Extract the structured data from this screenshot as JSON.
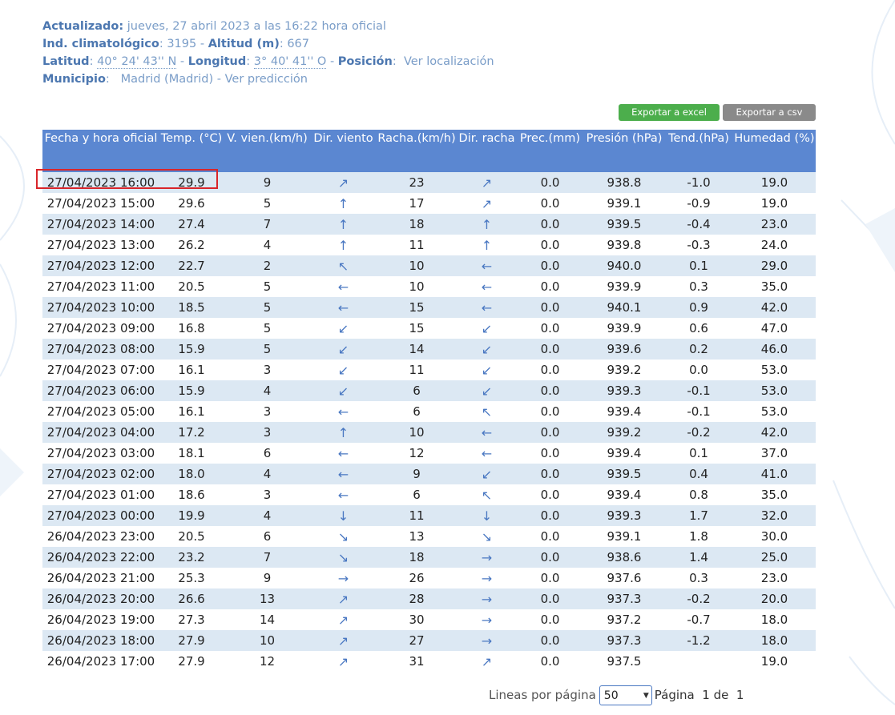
{
  "info": {
    "actualizado_label": "Actualizado:",
    "actualizado_value": "jueves, 27 abril 2023 a las 16:22 hora oficial",
    "ind_label": "Ind. climatológico",
    "ind_value": ": 3195 - ",
    "altitud_label": "Altitud (m)",
    "altitud_value": ": 667",
    "latitud_label": "Latitud",
    "latitud_value": "40° 24' 43'' N",
    "longitud_label": "Longitud",
    "longitud_value": "3° 40' 41'' O",
    "posicion_label": "Posición",
    "posicion_link": "Ver localización",
    "municipio_label": "Municipio",
    "municipio_value": "Madrid (Madrid)",
    "prediccion_link": "Ver predicción"
  },
  "buttons": {
    "excel": "Exportar a excel",
    "csv": "Exportar a csv"
  },
  "table": {
    "headers": [
      "Fecha y hora oficial",
      "Temp. (°C)",
      "V. vien.(km/h)",
      "Dir. viento",
      "Racha.(km/h)",
      "Dir. racha",
      "Prec.(mm)",
      "Presión (hPa)",
      "Tend.(hPa)",
      "Humedad (%)"
    ],
    "rows": [
      [
        "27/04/2023 16:00",
        "29.9",
        "9",
        "ne",
        "23",
        "ne",
        "0.0",
        "938.8",
        "-1.0",
        "19.0"
      ],
      [
        "27/04/2023 15:00",
        "29.6",
        "5",
        "n",
        "17",
        "ne",
        "0.0",
        "939.1",
        "-0.9",
        "19.0"
      ],
      [
        "27/04/2023 14:00",
        "27.4",
        "7",
        "n",
        "18",
        "n",
        "0.0",
        "939.5",
        "-0.4",
        "23.0"
      ],
      [
        "27/04/2023 13:00",
        "26.2",
        "4",
        "n",
        "11",
        "n",
        "0.0",
        "939.8",
        "-0.3",
        "24.0"
      ],
      [
        "27/04/2023 12:00",
        "22.7",
        "2",
        "nw",
        "10",
        "w",
        "0.0",
        "940.0",
        "0.1",
        "29.0"
      ],
      [
        "27/04/2023 11:00",
        "20.5",
        "5",
        "w",
        "10",
        "w",
        "0.0",
        "939.9",
        "0.3",
        "35.0"
      ],
      [
        "27/04/2023 10:00",
        "18.5",
        "5",
        "w",
        "15",
        "w",
        "0.0",
        "940.1",
        "0.9",
        "42.0"
      ],
      [
        "27/04/2023 09:00",
        "16.8",
        "5",
        "sw",
        "15",
        "sw",
        "0.0",
        "939.9",
        "0.6",
        "47.0"
      ],
      [
        "27/04/2023 08:00",
        "15.9",
        "5",
        "sw",
        "14",
        "sw",
        "0.0",
        "939.6",
        "0.2",
        "46.0"
      ],
      [
        "27/04/2023 07:00",
        "16.1",
        "3",
        "sw",
        "11",
        "sw",
        "0.0",
        "939.2",
        "0.0",
        "53.0"
      ],
      [
        "27/04/2023 06:00",
        "15.9",
        "4",
        "sw",
        "6",
        "sw",
        "0.0",
        "939.3",
        "-0.1",
        "53.0"
      ],
      [
        "27/04/2023 05:00",
        "16.1",
        "3",
        "w",
        "6",
        "nw",
        "0.0",
        "939.4",
        "-0.1",
        "53.0"
      ],
      [
        "27/04/2023 04:00",
        "17.2",
        "3",
        "n",
        "10",
        "w",
        "0.0",
        "939.2",
        "-0.2",
        "42.0"
      ],
      [
        "27/04/2023 03:00",
        "18.1",
        "6",
        "w",
        "12",
        "w",
        "0.0",
        "939.4",
        "0.1",
        "37.0"
      ],
      [
        "27/04/2023 02:00",
        "18.0",
        "4",
        "w",
        "9",
        "sw",
        "0.0",
        "939.5",
        "0.4",
        "41.0"
      ],
      [
        "27/04/2023 01:00",
        "18.6",
        "3",
        "w",
        "6",
        "nw",
        "0.0",
        "939.4",
        "0.8",
        "35.0"
      ],
      [
        "27/04/2023 00:00",
        "19.9",
        "4",
        "s",
        "11",
        "s",
        "0.0",
        "939.3",
        "1.7",
        "32.0"
      ],
      [
        "26/04/2023 23:00",
        "20.5",
        "6",
        "se",
        "13",
        "se",
        "0.0",
        "939.1",
        "1.8",
        "30.0"
      ],
      [
        "26/04/2023 22:00",
        "23.2",
        "7",
        "se",
        "18",
        "e",
        "0.0",
        "938.6",
        "1.4",
        "25.0"
      ],
      [
        "26/04/2023 21:00",
        "25.3",
        "9",
        "e",
        "26",
        "e",
        "0.0",
        "937.6",
        "0.3",
        "23.0"
      ],
      [
        "26/04/2023 20:00",
        "26.6",
        "13",
        "ne",
        "28",
        "e",
        "0.0",
        "937.3",
        "-0.2",
        "20.0"
      ],
      [
        "26/04/2023 19:00",
        "27.3",
        "14",
        "ne",
        "30",
        "e",
        "0.0",
        "937.2",
        "-0.7",
        "18.0"
      ],
      [
        "26/04/2023 18:00",
        "27.9",
        "10",
        "ne",
        "27",
        "e",
        "0.0",
        "937.3",
        "-1.2",
        "18.0"
      ],
      [
        "26/04/2023 17:00",
        "27.9",
        "12",
        "ne",
        "31",
        "ne",
        "0.0",
        "937.5",
        "",
        "19.0"
      ]
    ]
  },
  "pager": {
    "lines_label": "Lineas por página",
    "lines_value": "50",
    "page_label": "Página",
    "page_current": "1",
    "of_label": "de",
    "page_total": "1"
  }
}
